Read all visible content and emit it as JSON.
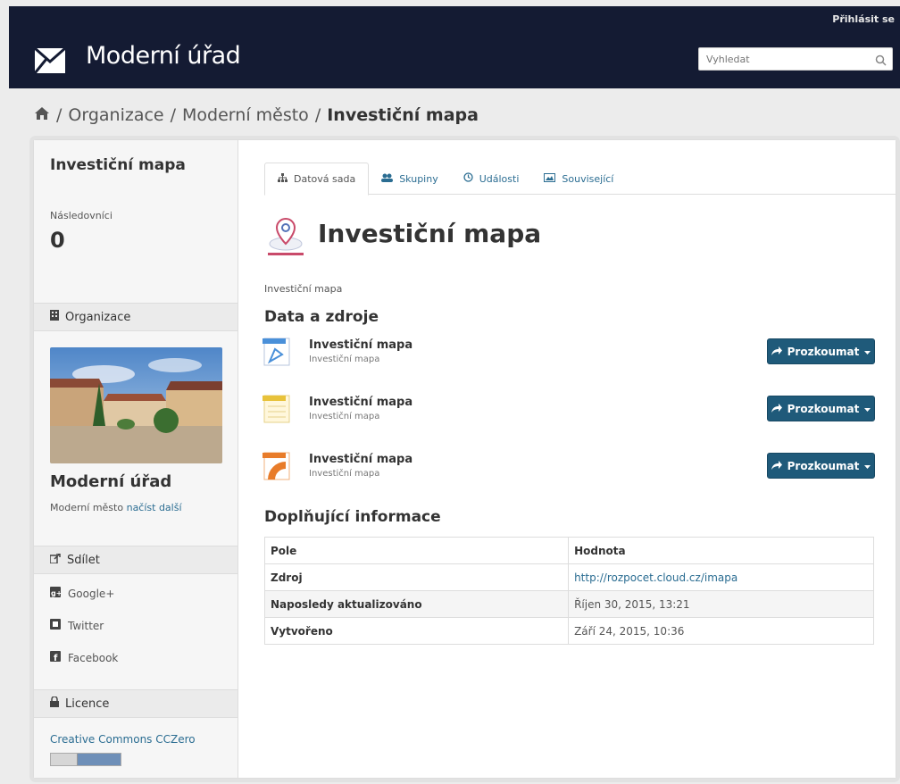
{
  "header": {
    "login": "Přihlásit se",
    "site_title": "Moderní úřad",
    "search_placeholder": "Vyhledat"
  },
  "breadcrumb": {
    "items": [
      "Organizace",
      "Moderní město"
    ],
    "current": "Investiční mapa"
  },
  "sidebar": {
    "title": "Investiční mapa",
    "followers_label": "Následovníci",
    "followers_count": "0",
    "org_heading": "Organizace",
    "org_name": "Moderní úřad",
    "org_desc": "Moderní město",
    "read_more": "načíst další",
    "share_heading": "Sdílet",
    "share_items": [
      "Google+",
      "Twitter",
      "Facebook"
    ],
    "license_heading": "Licence",
    "license_link": "Creative Commons CCZero"
  },
  "tabs": [
    "Datová sada",
    "Skupiny",
    "Události",
    "Související"
  ],
  "dataset": {
    "title": "Investiční mapa",
    "description": "Investiční mapa",
    "resources_heading": "Data a zdroje",
    "resources": [
      {
        "title": "Investiční mapa",
        "description": "Investiční mapa",
        "format_color": "#4a90d9",
        "button": "Prozkoumat"
      },
      {
        "title": "Investiční mapa",
        "description": "Investiční mapa",
        "format_color": "#e8c23a",
        "button": "Prozkoumat"
      },
      {
        "title": "Investiční mapa",
        "description": "Investiční mapa",
        "format_color": "#e87c2a",
        "button": "Prozkoumat"
      }
    ],
    "extra_heading": "Doplňující informace",
    "table": {
      "headers": [
        "Pole",
        "Hodnota"
      ],
      "rows": [
        {
          "field": "Zdroj",
          "value": "http://rozpocet.cloud.cz/imapa"
        },
        {
          "field": "Naposledy aktualizováno",
          "value": "Říjen 30, 2015, 13:21"
        },
        {
          "field": "Vytvořeno",
          "value": "Září 24, 2015, 10:36"
        }
      ]
    }
  },
  "colors": {
    "header_bg": "#141b33",
    "link": "#2b6d92",
    "button_bg": "#1f5a7a"
  }
}
